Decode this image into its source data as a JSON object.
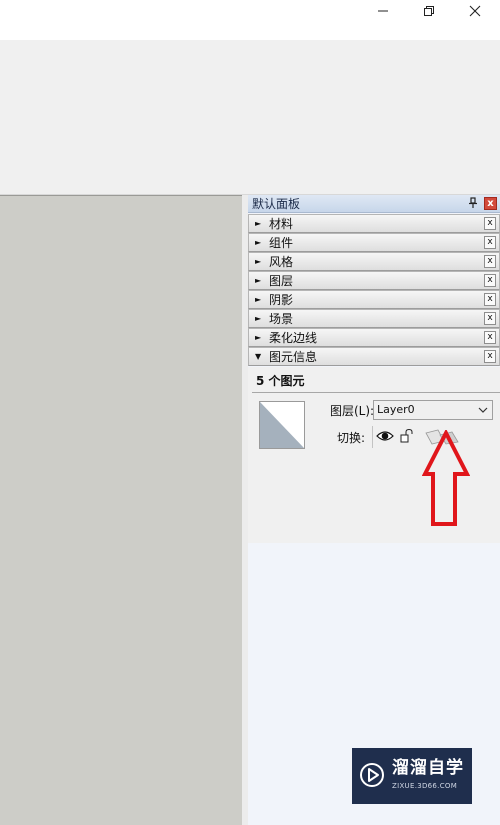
{
  "window": {
    "controls": {
      "minimize": "minimize",
      "restore": "restore",
      "close": "close"
    }
  },
  "tray": {
    "title": "默认面板",
    "pin_glyph": "ᵽ",
    "close_glyph": "x",
    "panels": [
      {
        "label": "材料",
        "arrow": "►",
        "close": "x"
      },
      {
        "label": "组件",
        "arrow": "►",
        "close": "x"
      },
      {
        "label": "风格",
        "arrow": "►",
        "close": "x"
      },
      {
        "label": "图层",
        "arrow": "►",
        "close": "x"
      },
      {
        "label": "阴影",
        "arrow": "►",
        "close": "x"
      },
      {
        "label": "场景",
        "arrow": "►",
        "close": "x"
      },
      {
        "label": "柔化边线",
        "arrow": "►",
        "close": "x"
      },
      {
        "label": "图元信息",
        "arrow": "▼",
        "close": "x"
      }
    ]
  },
  "entity_info": {
    "count_text": "5 个图元",
    "layer_label": "图层(L):",
    "layer_value": "Layer0",
    "toggle_label": "切换:"
  },
  "watermark": {
    "name": "溜溜自学",
    "url": "ZIXUE.3D66.COM"
  },
  "colors": {
    "annotation_arrow": "#e0161b",
    "tray_close": "#d24a3c",
    "viewport_bg": "#cdcdc8",
    "watermark_bg": "#1f2e4d"
  }
}
